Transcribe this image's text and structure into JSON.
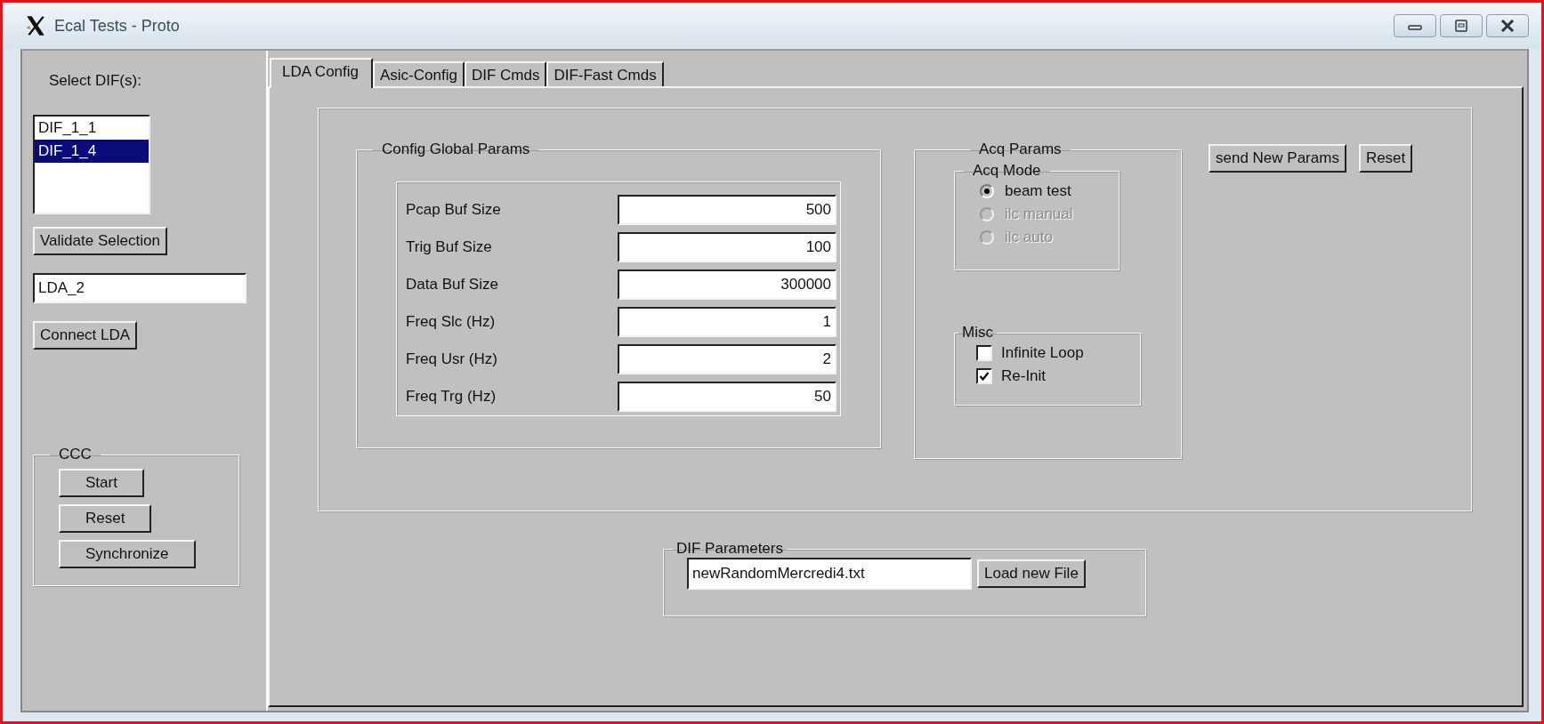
{
  "window": {
    "title": "Ecal Tests - Proto"
  },
  "sidebar": {
    "select_label": "Select DIF(s):",
    "dif_list": [
      {
        "label": "DIF_1_1",
        "selected": false
      },
      {
        "label": "DIF_1_4",
        "selected": true
      }
    ],
    "validate_button": "Validate Selection",
    "lda_field": {
      "value": "LDA_2"
    },
    "connect_button": "Connect LDA",
    "ccc": {
      "title": "CCC",
      "buttons": [
        "Start",
        "Reset",
        "Synchronize"
      ]
    }
  },
  "tabs": [
    {
      "label": "LDA Config",
      "selected": true
    },
    {
      "label": "Asic-Config",
      "selected": false
    },
    {
      "label": "DIF Cmds",
      "selected": false
    },
    {
      "label": "DIF-Fast Cmds",
      "selected": false
    }
  ],
  "lda_config": {
    "config_global_params": {
      "title": "Config Global Params",
      "params": [
        {
          "label": "Pcap Buf Size",
          "value": "500"
        },
        {
          "label": "Trig Buf Size",
          "value": "100"
        },
        {
          "label": "Data Buf Size",
          "value": "300000"
        },
        {
          "label": "Freq Slc (Hz)",
          "value": "1"
        },
        {
          "label": "Freq Usr (Hz)",
          "value": "2"
        },
        {
          "label": "Freq Trg (Hz)",
          "value": "50"
        }
      ]
    },
    "acq_params": {
      "title": "Acq Params",
      "acq_mode": {
        "title": "Acq Mode",
        "options": [
          {
            "label": "beam test",
            "selected": true,
            "disabled": false
          },
          {
            "label": "ilc manual",
            "selected": false,
            "disabled": true
          },
          {
            "label": "ilc auto",
            "selected": false,
            "disabled": true
          }
        ]
      },
      "misc": {
        "title": "Misc",
        "options": [
          {
            "label": "Infinite Loop",
            "checked": false
          },
          {
            "label": "Re-Init",
            "checked": true
          }
        ]
      }
    },
    "buttons": [
      "send New Params",
      "Reset"
    ],
    "dif_parameters": {
      "title": "DIF Parameters",
      "file": {
        "value": "newRandomMercredi4.txt"
      },
      "load_button": "Load new File"
    }
  }
}
